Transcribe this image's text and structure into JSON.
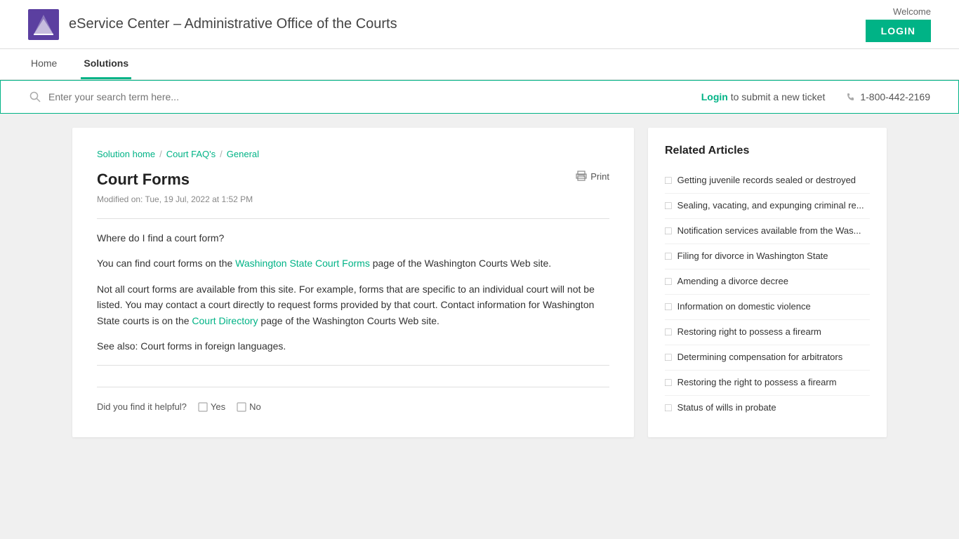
{
  "header": {
    "welcome_text": "Welcome",
    "login_button": "LOGIN",
    "site_title": "eService Center – Administrative Office of the Courts"
  },
  "nav": {
    "items": [
      {
        "label": "Home",
        "active": false
      },
      {
        "label": "Solutions",
        "active": true
      }
    ]
  },
  "search": {
    "placeholder": "Enter your search term here...",
    "login_label": "Login",
    "ticket_text": "to submit a new ticket",
    "phone": "1-800-442-2169"
  },
  "breadcrumb": {
    "solution_home": "Solution home",
    "court_faqs": "Court FAQ's",
    "general": "General"
  },
  "article": {
    "title": "Court Forms",
    "modified": "Modified on: Tue, 19 Jul, 2022 at 1:52 PM",
    "print_label": "Print",
    "question": "Where do I find a court form?",
    "body1": "You can find court forms on the ",
    "body1_link": "Washington State Court Forms",
    "body1_cont": " page of the Washington Courts Web site.",
    "body2": "Not all court forms are available from this site.  For example, forms that are specific to an individual court will not be listed.  You may contact a court directly to request forms provided by that court.  Contact information for Washington State courts is on the ",
    "body2_link": "Court Directory",
    "body2_cont": " page of the Washington Courts Web site.",
    "see_also": "See also:  Court forms in foreign languages.",
    "helpful_label": "Did you find it helpful?",
    "yes_label": "Yes",
    "no_label": "No"
  },
  "related": {
    "title": "Related Articles",
    "items": [
      {
        "label": "Getting juvenile records sealed or destroyed"
      },
      {
        "label": "Sealing, vacating, and expunging criminal re..."
      },
      {
        "label": "Notification services available from the Was..."
      },
      {
        "label": "Filing for divorce in Washington State"
      },
      {
        "label": "Amending a divorce decree"
      },
      {
        "label": "Information on domestic violence"
      },
      {
        "label": "Restoring right to possess a firearm"
      },
      {
        "label": "Determining compensation for arbitrators"
      },
      {
        "label": "Restoring the right to possess a firearm"
      },
      {
        "label": "Status of wills in probate"
      }
    ]
  }
}
